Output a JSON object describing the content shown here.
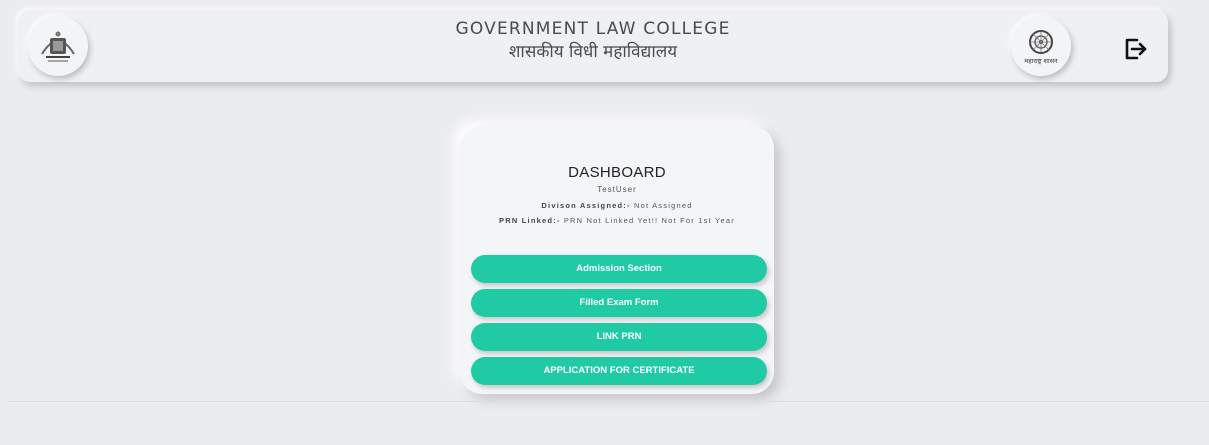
{
  "header": {
    "title_en": "GOVERNMENT LAW COLLEGE",
    "title_hi": "शासकीय विधी महाविद्यालय",
    "left_logo_icon": "college-emblem-icon",
    "right_logo_icon": "maharashtra-govt-seal-icon",
    "right_logo_caption": "महाराष्ट्र शासन",
    "logout_icon": "logout-icon"
  },
  "dashboard": {
    "title": "DASHBOARD",
    "username": "TestUser",
    "division_label": "Divison Assigned:-",
    "division_value": "Not Assigned",
    "prn_label": "PRN Linked:-",
    "prn_value": "PRN Not Linked Yet!! Not For 1st Year",
    "buttons": [
      {
        "label": "Admission Section"
      },
      {
        "label": "Filled Exam Form"
      },
      {
        "label": "LINK PRN"
      },
      {
        "label": "APPLICATION FOR CERTIFICATE"
      }
    ]
  },
  "colors": {
    "background": "#ebecf0",
    "button": "#1fcaa4",
    "button_text": "#ffffff"
  }
}
